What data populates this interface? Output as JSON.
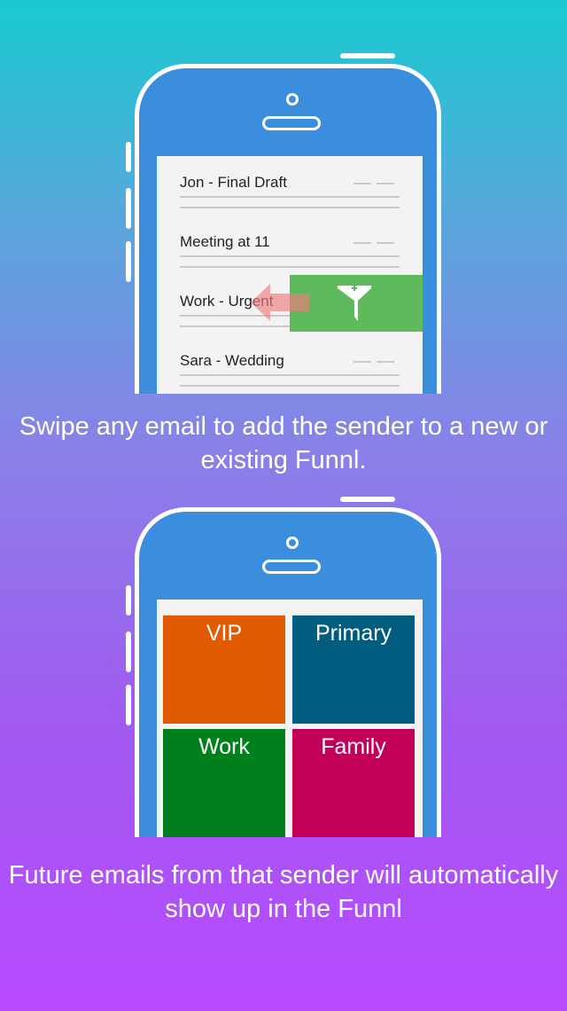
{
  "emails": [
    {
      "subject": "Jon - Final Draft"
    },
    {
      "subject": "Meeting at 11"
    },
    {
      "subject": "Work - Urgent"
    },
    {
      "subject": "Sara - Wedding"
    }
  ],
  "swipe_action": {
    "icon": "funnel-add-icon",
    "color": "#5fba5b",
    "arrow_color": "#f07e7e"
  },
  "captions": {
    "first": "Swipe any email to add the sender to a new or existing Funnl.",
    "second": "Future emails from that sender will automatically show up in the Funnl"
  },
  "funnels": [
    {
      "label": "VIP",
      "color": "#e15a00"
    },
    {
      "label": "Primary",
      "color": "#005d80"
    },
    {
      "label": "Work",
      "color": "#00801c"
    },
    {
      "label": "Family",
      "color": "#c2005a"
    }
  ]
}
